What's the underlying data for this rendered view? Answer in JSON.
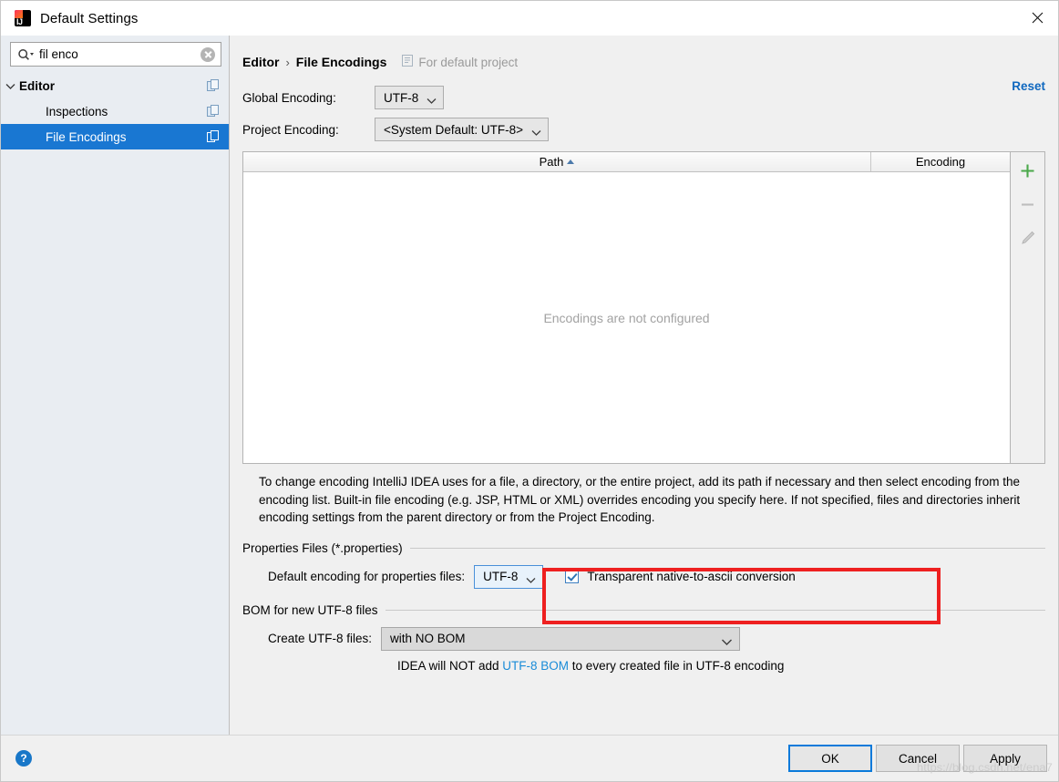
{
  "window": {
    "title": "Default Settings",
    "app_icon": "intellij-idea-logo",
    "close_label": "✕"
  },
  "sidebar": {
    "search": {
      "value": "fil enco",
      "placeholder": "",
      "search_icon": "search-icon",
      "clear_icon": "clear-icon"
    },
    "items": [
      {
        "label": "Editor",
        "level": 1,
        "selected": false,
        "expanded": true,
        "copy_icon": "copy-icon"
      },
      {
        "label": "Inspections",
        "level": 2,
        "selected": false,
        "expanded": false,
        "copy_icon": "copy-icon"
      },
      {
        "label": "File Encodings",
        "level": 2,
        "selected": true,
        "expanded": false,
        "copy_icon": "copy-icon"
      }
    ]
  },
  "content": {
    "breadcrumb": {
      "root": "Editor",
      "separator": "›",
      "leaf": "File Encodings"
    },
    "scope_note": {
      "icon": "project-icon",
      "text": "For default project"
    },
    "reset_label": "Reset",
    "global_encoding": {
      "label": "Global Encoding:",
      "value": "UTF-8"
    },
    "project_encoding": {
      "label": "Project Encoding:",
      "value": "<System Default: UTF-8>"
    },
    "table": {
      "columns": [
        "Path",
        "Encoding"
      ],
      "sort_column": "Path",
      "sort_direction": "ascending",
      "rows": [],
      "empty_text": "Encodings are not configured",
      "toolbar": [
        {
          "name": "add-button",
          "glyph": "+",
          "enabled": true
        },
        {
          "name": "remove-button",
          "glyph": "−",
          "enabled": false
        },
        {
          "name": "edit-button",
          "glyph": "pencil",
          "enabled": false
        }
      ]
    },
    "description": "To change encoding IntelliJ IDEA uses for a file, a directory, or the entire project, add its path if necessary and then select encoding from the encoding list. Built-in file encoding (e.g. JSP, HTML or XML) overrides encoding you specify here. If not specified, files and directories inherit encoding settings from the parent directory or from the Project Encoding.",
    "properties_group": {
      "title": "Properties Files (*.properties)",
      "encoding_label": "Default encoding for properties files:",
      "encoding_value": "UTF-8",
      "checkbox_label": "Transparent native-to-ascii conversion",
      "checkbox_checked": true,
      "highlight_color": "#ee2020"
    },
    "bom_group": {
      "title": "BOM for new UTF-8 files",
      "create_label": "Create UTF-8 files:",
      "create_value": "with NO BOM",
      "note_prefix": "IDEA will NOT add ",
      "note_link": "UTF-8 BOM",
      "note_suffix": " to every created file in UTF-8 encoding"
    }
  },
  "footer": {
    "help_glyph": "?",
    "buttons": [
      {
        "label": "OK",
        "default": true
      },
      {
        "label": "Cancel",
        "default": false
      },
      {
        "label": "Apply",
        "default": false
      }
    ]
  },
  "watermark": "https://blog.csdn.net/ena7"
}
